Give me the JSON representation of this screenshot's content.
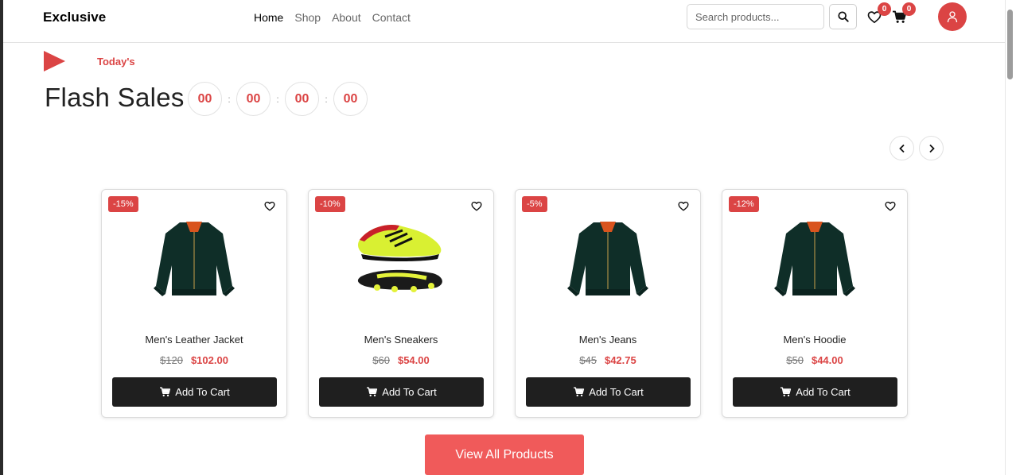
{
  "header": {
    "logo": "Exclusive",
    "nav": [
      "Home",
      "Shop",
      "About",
      "Contact"
    ],
    "active_nav": "Home",
    "search_placeholder": "Search products...",
    "wishlist_count": "0",
    "cart_count": "0"
  },
  "section": {
    "tag": "Today's",
    "title": "Flash Sales",
    "timer": [
      "00",
      "00",
      "00",
      "00"
    ]
  },
  "products": [
    {
      "discount": "-15%",
      "name": "Men's Leather Jacket",
      "old_price": "$120",
      "new_price": "$102.00",
      "image": "jacket-image"
    },
    {
      "discount": "-10%",
      "name": "Men's Sneakers",
      "old_price": "$60",
      "new_price": "$54.00",
      "image": "sneakers-image"
    },
    {
      "discount": "-5%",
      "name": "Men's Jeans",
      "old_price": "$45",
      "new_price": "$42.75",
      "image": "jacket-image"
    },
    {
      "discount": "-12%",
      "name": "Men's Hoodie",
      "old_price": "$50",
      "new_price": "$44.00",
      "image": "jacket-image"
    }
  ],
  "add_to_cart_label": "Add To Cart",
  "view_all_label": "View All Products",
  "colors": {
    "accent": "#db4444",
    "button_dark": "#1f1f1f"
  }
}
